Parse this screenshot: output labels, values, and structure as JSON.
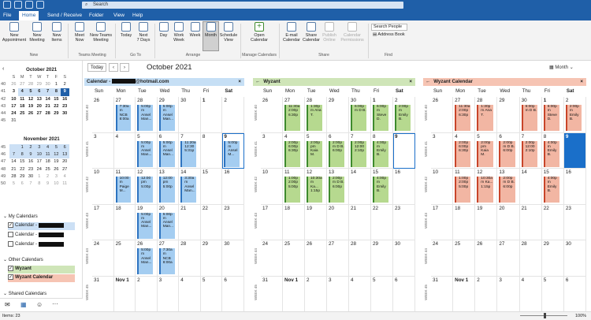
{
  "titlebar": {
    "search_placeholder": "Search"
  },
  "menubar": {
    "items": [
      "File",
      "Home",
      "Send / Receive",
      "Folder",
      "View",
      "Help"
    ]
  },
  "ribbon": {
    "buttons": [
      {
        "label": "New\nAppointment"
      },
      {
        "label": "New\nMeeting"
      },
      {
        "label": "New\nItems"
      },
      {
        "label": "Meet\nNow"
      },
      {
        "label": "New Teams\nMeeting"
      },
      {
        "label": "Today"
      },
      {
        "label": "Next\n7 Days"
      },
      {
        "label": "Day"
      },
      {
        "label": "Work\nWeek"
      },
      {
        "label": "Week"
      },
      {
        "label": "Month"
      },
      {
        "label": "Schedule\nView"
      },
      {
        "label": "Open\nCalendar"
      },
      {
        "label": "E-mail\nCalendar"
      },
      {
        "label": "Share\nCalendar"
      },
      {
        "label": "Publish\nOnline"
      },
      {
        "label": "Calendar\nPermissions"
      }
    ],
    "groups": [
      "New",
      "Teams Meeting",
      "Go To",
      "Arrange",
      "Manage Calendars",
      "Share",
      "Find"
    ],
    "search_people": "Search People",
    "address_book": "Address Book"
  },
  "mini_oct": {
    "title": "October 2021",
    "headers": [
      "S",
      "M",
      "T",
      "W",
      "T",
      "F",
      "S"
    ],
    "weeks": [
      {
        "wk": "40",
        "days": [
          "26",
          "27",
          "28",
          "29",
          "30",
          "1",
          "2"
        ]
      },
      {
        "wk": "41",
        "days": [
          "3",
          "4",
          "5",
          "6",
          "7",
          "8",
          "9"
        ]
      },
      {
        "wk": "42",
        "days": [
          "10",
          "11",
          "12",
          "13",
          "14",
          "15",
          "16"
        ]
      },
      {
        "wk": "43",
        "days": [
          "17",
          "18",
          "19",
          "20",
          "21",
          "22",
          "23"
        ]
      },
      {
        "wk": "44",
        "days": [
          "24",
          "25",
          "26",
          "27",
          "28",
          "29",
          "30"
        ]
      },
      {
        "wk": "45",
        "days": [
          "31",
          "",
          "",
          "",
          "",
          "",
          ""
        ]
      }
    ]
  },
  "mini_nov": {
    "title": "November 2021",
    "weeks": [
      {
        "wk": "45",
        "days": [
          "",
          "1",
          "2",
          "3",
          "4",
          "5",
          "6"
        ]
      },
      {
        "wk": "46",
        "days": [
          "7",
          "8",
          "9",
          "10",
          "11",
          "12",
          "13"
        ]
      },
      {
        "wk": "47",
        "days": [
          "14",
          "15",
          "16",
          "17",
          "18",
          "19",
          "20"
        ]
      },
      {
        "wk": "48",
        "days": [
          "21",
          "22",
          "23",
          "24",
          "25",
          "26",
          "27"
        ]
      },
      {
        "wk": "49",
        "days": [
          "28",
          "29",
          "30",
          "1",
          "2",
          "3",
          "4"
        ]
      },
      {
        "wk": "50",
        "days": [
          "5",
          "6",
          "7",
          "8",
          "9",
          "10",
          "11"
        ]
      }
    ]
  },
  "folders": {
    "my_calendars": "My Calendars",
    "cal1": "Calendar - ",
    "cal2": "Calendar - ",
    "cal3": "Calendar - ",
    "other_calendars": "Other Calendars",
    "wyzant": "Wyzant",
    "wyzant_calendar": "Wyzant Calendar",
    "shared_calendars": "Shared Calendars"
  },
  "toolbar": {
    "today": "Today",
    "prev": "‹",
    "next": "›",
    "title": "October 2021",
    "view": "Month"
  },
  "day_headers": [
    "Sun",
    "Mon",
    "Tue",
    "Wed",
    "Thu",
    "Fri",
    "Sat"
  ],
  "week_labels": [
    "WEEK 40",
    "WEEK 41",
    "WEEK 42",
    "WEEK 43",
    "WEEK 44",
    "WEEK 45"
  ],
  "week_days": [
    [
      "26",
      "27",
      "28",
      "29",
      "30",
      "1",
      "2"
    ],
    [
      "3",
      "4",
      "5",
      "6",
      "7",
      "8",
      "9"
    ],
    [
      "10",
      "11",
      "12",
      "13",
      "14",
      "15",
      "16"
    ],
    [
      "17",
      "18",
      "19",
      "20",
      "21",
      "22",
      "23"
    ],
    [
      "24",
      "25",
      "26",
      "27",
      "28",
      "29",
      "30"
    ],
    [
      "31",
      "Nov 1",
      "2",
      "3",
      "4",
      "5",
      "6"
    ]
  ],
  "panes": [
    {
      "title": "Calendar - ",
      "title_suffix": "@hotmail.com",
      "color": "blue",
      "close": "×",
      "arrow": ""
    },
    {
      "title": "Wyzant",
      "title_suffix": "",
      "color": "green",
      "close": "×",
      "arrow": "←"
    },
    {
      "title": "Wyzant Calendar",
      "title_suffix": "",
      "color": "red",
      "close": "×",
      "arrow": "←"
    }
  ],
  "events": {
    "blue": [
      {
        "w": 0,
        "d": 1,
        "text": "7:30a m NCB 8:00a"
      },
      {
        "w": 0,
        "d": 2,
        "text": "5:00p m Ansel Man..."
      },
      {
        "w": 0,
        "d": 3,
        "text": "5:00p m Ansel Man..."
      },
      {
        "w": 1,
        "d": 2,
        "text": "5:00p m Ansel Man..."
      },
      {
        "w": 1,
        "d": 3,
        "text": "5:00p m Ansel Man..."
      },
      {
        "w": 1,
        "d": 4,
        "text": "11:20a 12:30 5:31p"
      },
      {
        "w": 1,
        "d": 6,
        "text": "5:00p m Ansel M..."
      },
      {
        "w": 2,
        "d": 1,
        "text": "10:00 m Paige M..."
      },
      {
        "w": 2,
        "d": 2,
        "text": "12:00 pm 5:00p"
      },
      {
        "w": 2,
        "d": 3,
        "text": "12:00 pm 5:00p"
      },
      {
        "w": 2,
        "d": 4,
        "text": "3:30a m Ansel Man..."
      },
      {
        "w": 3,
        "d": 2,
        "text": "5:00p m Ansel Man..."
      },
      {
        "w": 3,
        "d": 3,
        "text": "5:00p m Ansel Man..."
      },
      {
        "w": 4,
        "d": 2,
        "text": "5:00p m Ansel Man..."
      },
      {
        "w": 4,
        "d": 3,
        "text": "7:30a m NCB 8:00a"
      }
    ],
    "green": [
      {
        "w": 0,
        "d": 1,
        "text": "11:30a 2:00p 6:30p"
      },
      {
        "w": 0,
        "d": 2,
        "text": "1:30p m Ana T."
      },
      {
        "w": 0,
        "d": 4,
        "text": "6:00p m D B."
      },
      {
        "w": 0,
        "d": 5,
        "text": "6:00p m Steve D."
      },
      {
        "w": 0,
        "d": 6,
        "text": "2:00p m Emily B."
      },
      {
        "w": 1,
        "d": 1,
        "text": "2:00p 6:00p 6:30p"
      },
      {
        "w": 1,
        "d": 2,
        "text": "2:00p pm Kaia M."
      },
      {
        "w": 1,
        "d": 3,
        "text": "2:00p m D B. 6:00p"
      },
      {
        "w": 1,
        "d": 4,
        "text": "2:00p 12:00 2:10p"
      },
      {
        "w": 1,
        "d": 5,
        "text": "4:00p m Emily B."
      },
      {
        "w": 2,
        "d": 1,
        "text": "1:00p 2:00p 5:00p"
      },
      {
        "w": 2,
        "d": 2,
        "text": "10:30a m Ka... 1:15p"
      },
      {
        "w": 2,
        "d": 3,
        "text": "2:00p m D B. 6:00p"
      },
      {
        "w": 2,
        "d": 5,
        "text": "4:00p m Emily B."
      }
    ],
    "red": [
      {
        "w": 0,
        "d": 1,
        "text": "11:30a 2:00p 6:30p"
      },
      {
        "w": 0,
        "d": 2,
        "text": "1:30p m Ana T."
      },
      {
        "w": 0,
        "d": 4,
        "text": "6:00p m D B."
      },
      {
        "w": 0,
        "d": 5,
        "text": "6:00p m Steve D."
      },
      {
        "w": 0,
        "d": 6,
        "text": "2:00p m Emily B."
      },
      {
        "w": 1,
        "d": 1,
        "text": "2:00p 6:00p 6:30p"
      },
      {
        "w": 1,
        "d": 2,
        "text": "2:00p pm Kaia M."
      },
      {
        "w": 1,
        "d": 3,
        "text": "2:00p m D B. 6:00p"
      },
      {
        "w": 1,
        "d": 4,
        "text": "2:00p 12:00 2:10p"
      },
      {
        "w": 1,
        "d": 5,
        "text": "4:00p m Emily B."
      },
      {
        "w": 2,
        "d": 1,
        "text": "1:00p 2:00p 5:00p"
      },
      {
        "w": 2,
        "d": 2,
        "text": "10:30a m Ka... 1:15p"
      },
      {
        "w": 2,
        "d": 3,
        "text": "2:00p m D B. 6:00p"
      },
      {
        "w": 2,
        "d": 5,
        "text": "4:00p m Emily B."
      }
    ]
  },
  "statusbar": {
    "items": "Items: 23",
    "zoom": "100%"
  },
  "colors": {
    "accent": "#1f5fa8",
    "today": "#1a6fc9",
    "blue_head": "#c6dff5",
    "green_head": "#cfe5b8",
    "red_head": "#f6c4b3"
  }
}
